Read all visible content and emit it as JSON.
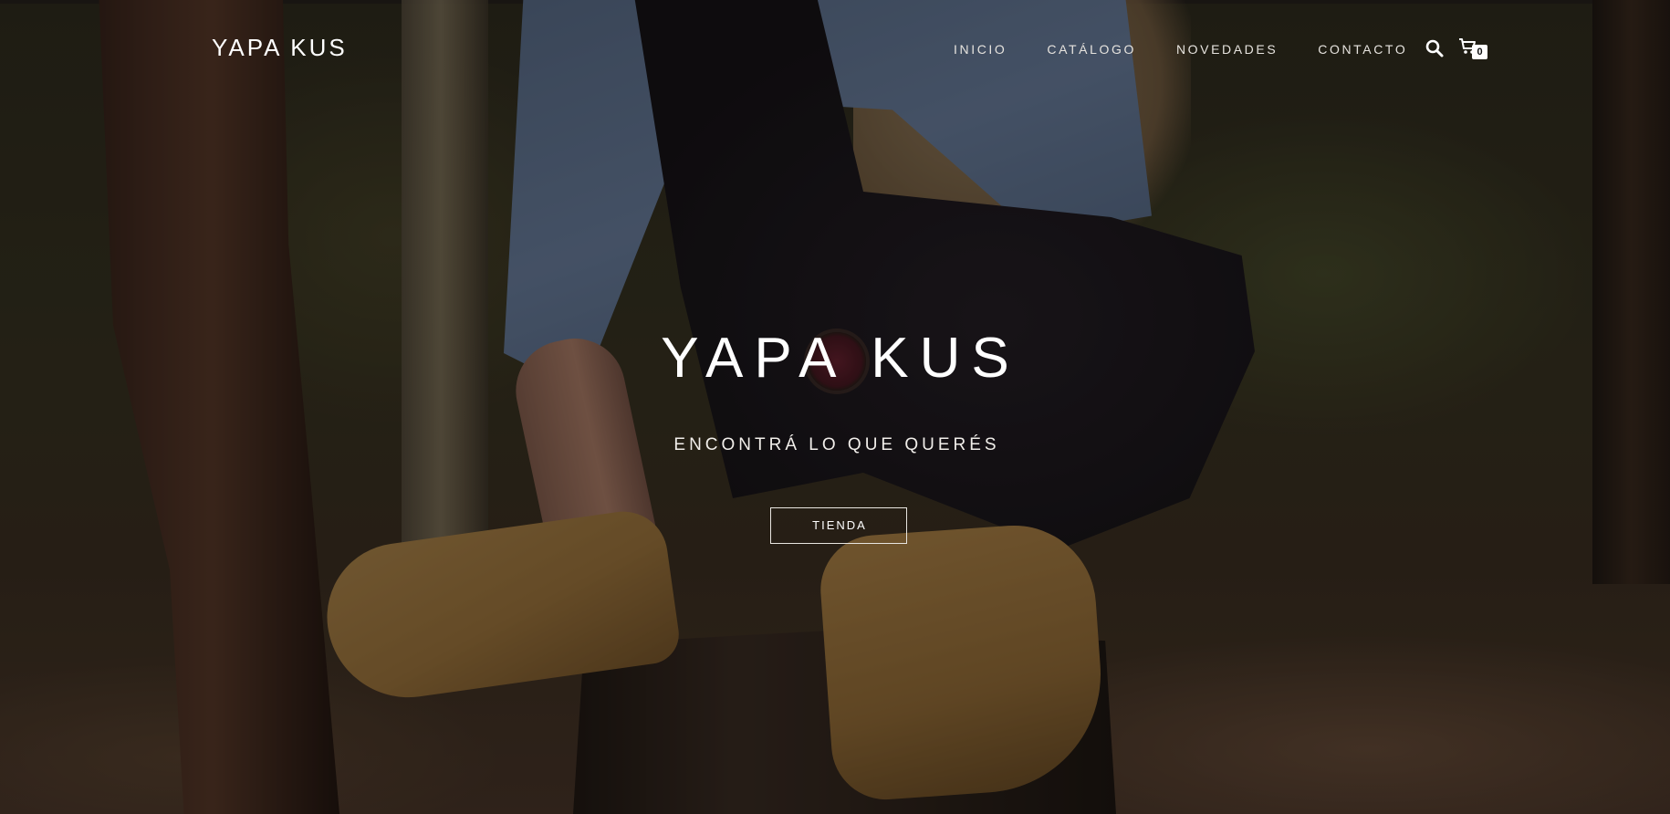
{
  "header": {
    "brand": "YAPA KUS",
    "nav": [
      {
        "label": "INICIO"
      },
      {
        "label": "CATÁLOGO"
      },
      {
        "label": "NOVEDADES"
      },
      {
        "label": "CONTACTO"
      }
    ],
    "search_icon": "search-icon",
    "cart": {
      "icon": "shopping-cart-icon",
      "count": "0"
    }
  },
  "hero": {
    "title": "YAPA KUS",
    "subtitle": "ENCONTRÁ LO QUE QUERÉS",
    "cta_label": "TIENDA"
  },
  "colors": {
    "text": "#ffffff",
    "overlay": "#0a0806"
  }
}
